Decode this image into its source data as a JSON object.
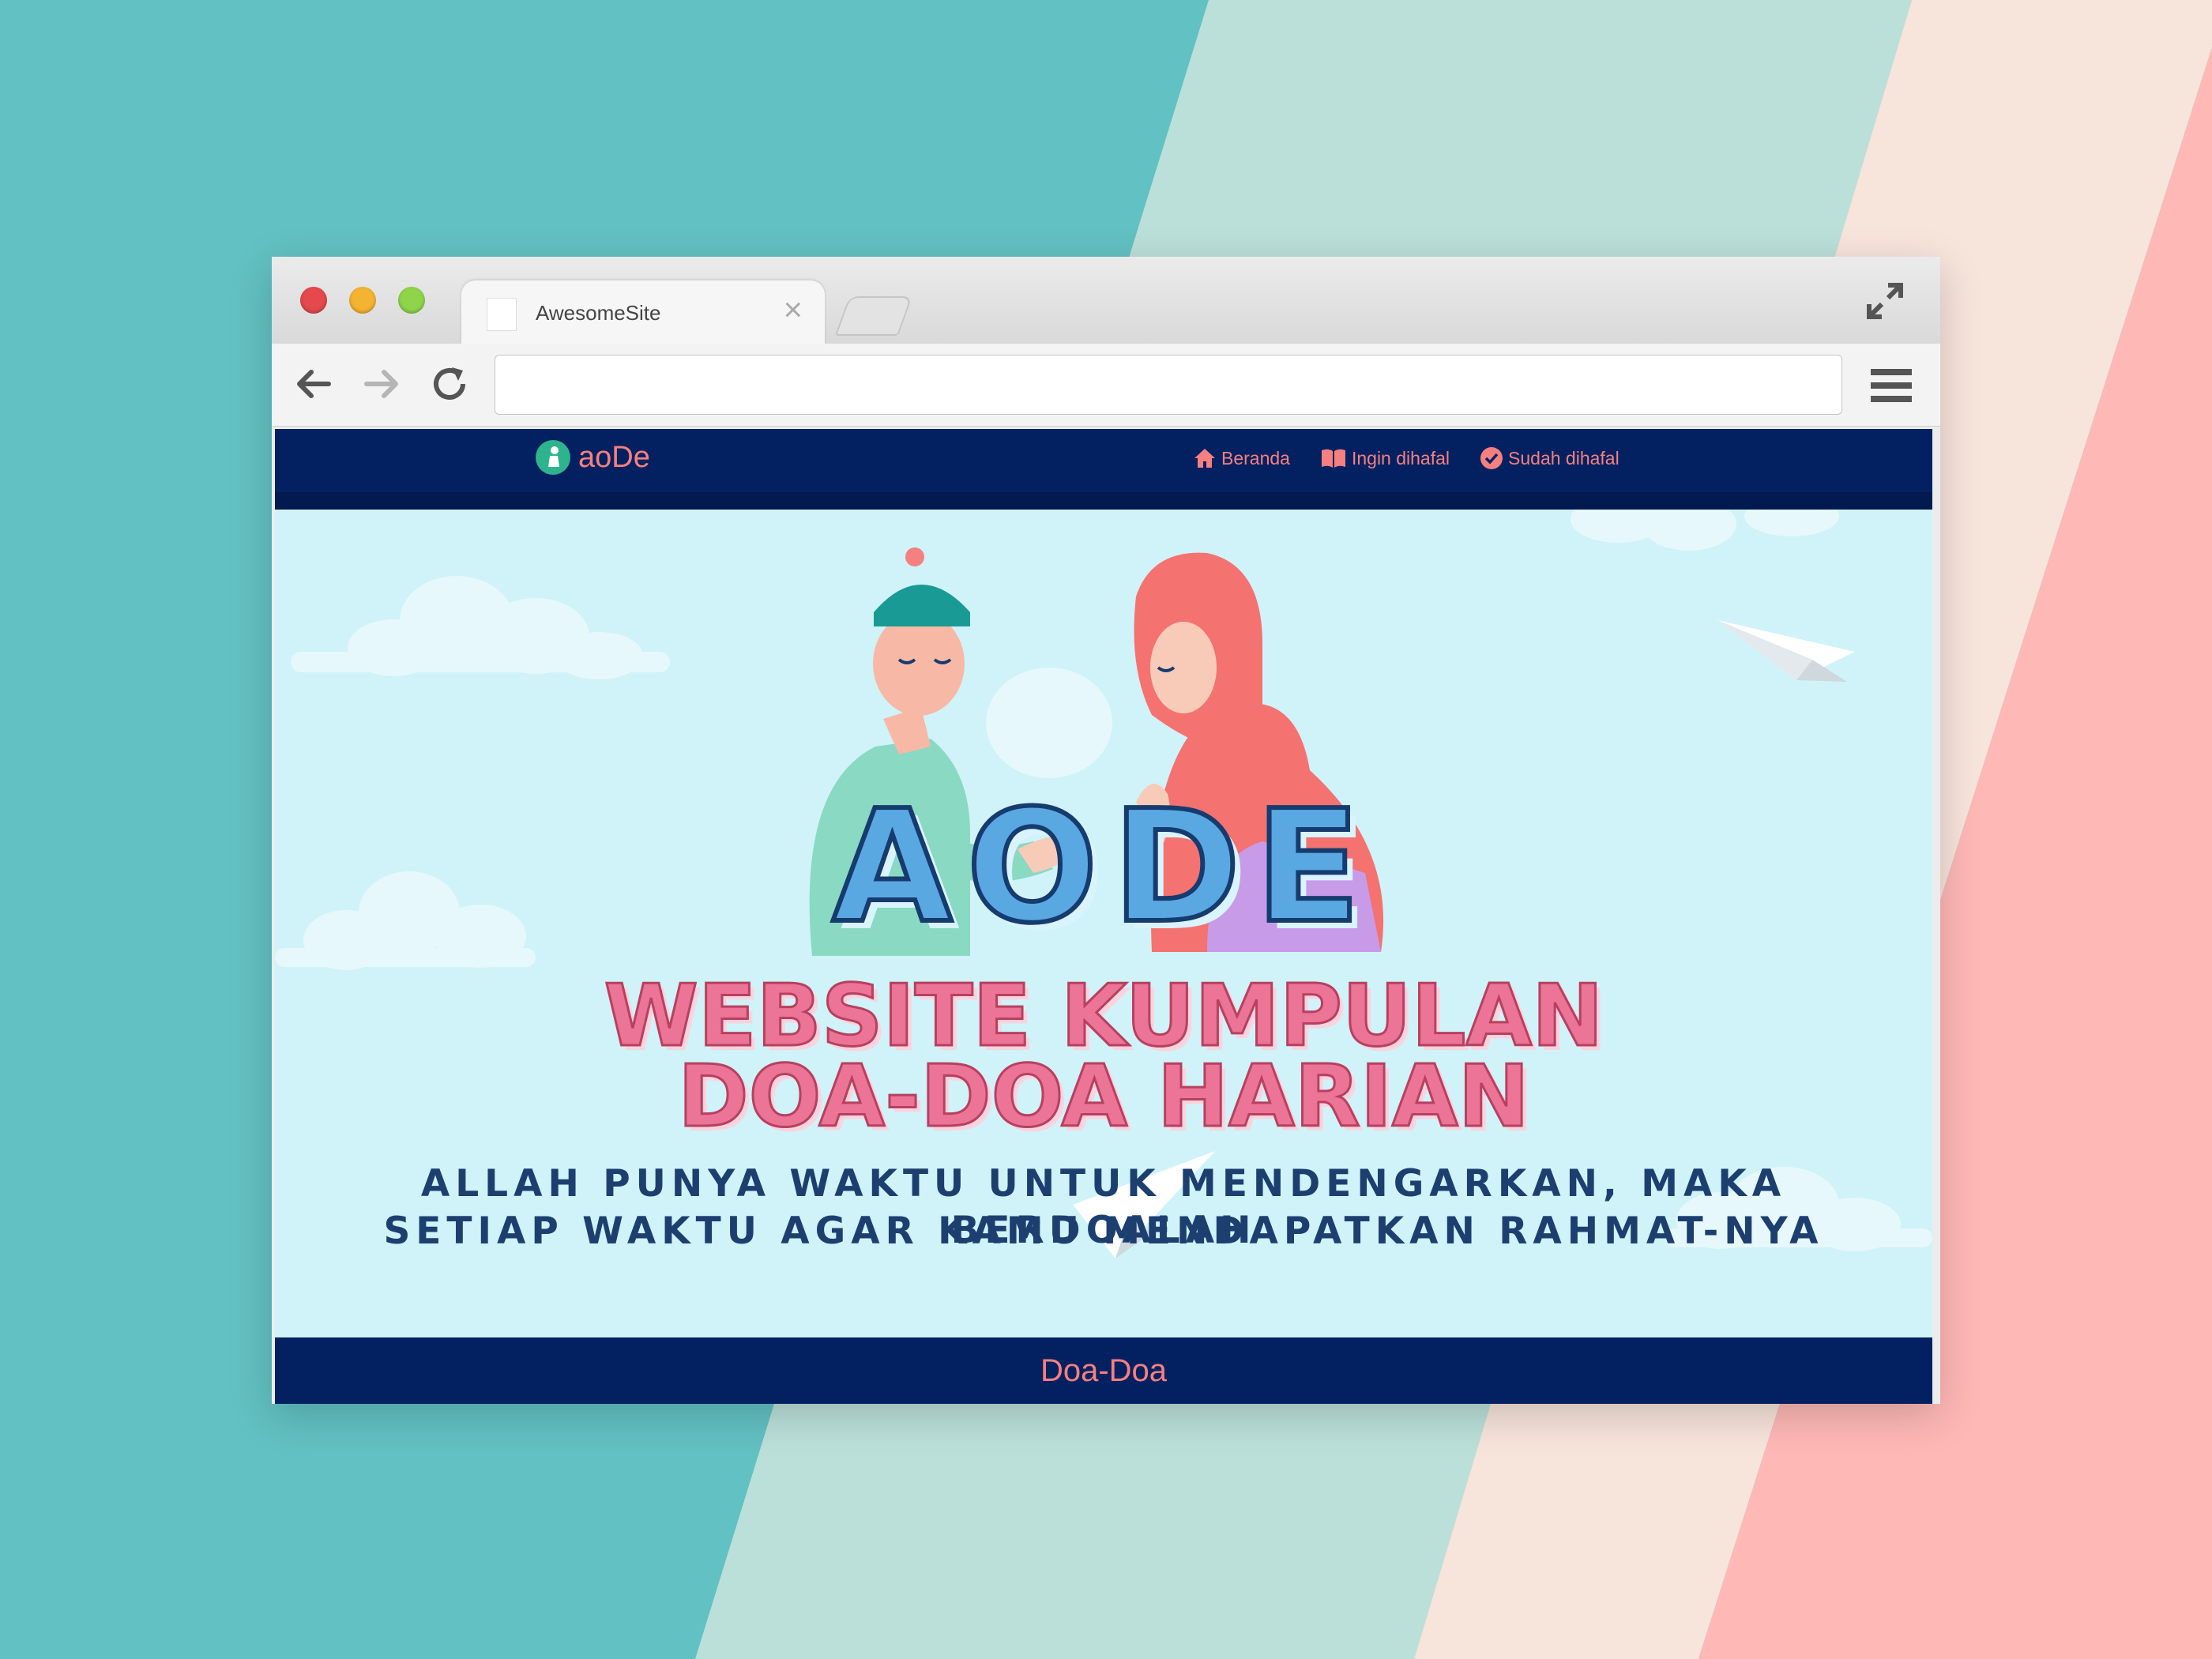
{
  "browser": {
    "tab_title": "AwesomeSite",
    "tab_close": "×",
    "url_value": ""
  },
  "site": {
    "logo_text": "aoDe",
    "nav": [
      {
        "label": "Beranda",
        "icon": "home-icon"
      },
      {
        "label": "Ingin dihafal",
        "icon": "book-icon"
      },
      {
        "label": "Sudah dihafal",
        "icon": "check-circle-icon"
      }
    ],
    "hero": {
      "heading": "AODE",
      "subheading_line1": "WEBSITE KUMPULAN",
      "subheading_line2": "DOA-DOA HARIAN",
      "tagline_line1": "ALLAH PUNYA WAKTU UNTUK MENDENGARKAN, MAKA BERDOALAH",
      "tagline_line2": "SETIAP WAKTU AGAR KAMU MENDAPATKAN RAHMAT-NYA"
    },
    "footer_text": "Doa-Doa"
  },
  "colors": {
    "nav_bg": "#032161",
    "accent": "#f5807f",
    "hero_bg": "#cff3f8",
    "heading_blue": "#5aa8e2",
    "heading_pink": "#ec7496",
    "tagline": "#1d3f70"
  }
}
